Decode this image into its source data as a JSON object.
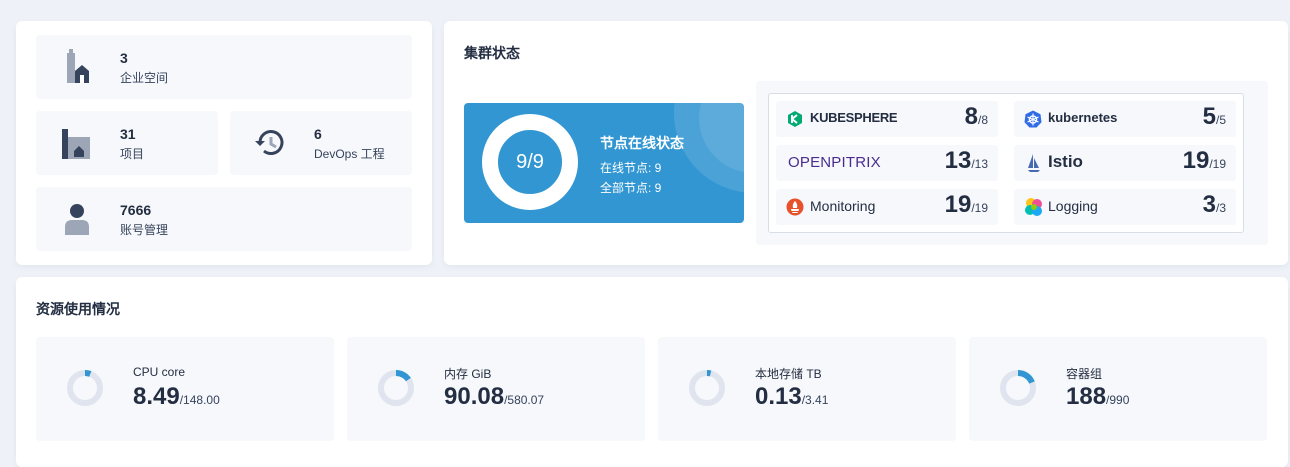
{
  "overview": {
    "workspaces": {
      "count": "3",
      "label": "企业空间",
      "icon": "enterprise-icon"
    },
    "projects": {
      "count": "31",
      "label": "项目",
      "icon": "project-icon"
    },
    "devops": {
      "count": "6",
      "label": "DevOps 工程",
      "icon": "history-icon"
    },
    "accounts": {
      "count": "7666",
      "label": "账号管理",
      "icon": "user-icon"
    }
  },
  "cluster": {
    "title": "集群状态",
    "ring_text": "9/9",
    "node_status_title": "节点在线状态",
    "online_nodes": "在线节点: 9",
    "total_nodes": "全部节点: 9",
    "accent": "#3196d1",
    "components": [
      {
        "name": "KUBESPHERE",
        "value": "8",
        "total": "/8",
        "icon": "kubesphere-logo-icon",
        "color": "#00aa72"
      },
      {
        "name": "kubernetes",
        "value": "5",
        "total": "/5",
        "icon": "kubernetes-logo-icon",
        "color": "#326ce5"
      },
      {
        "name": "OPENPITRIX",
        "value": "13",
        "total": "/13",
        "icon": "openpitrix-logo-icon",
        "color": "#4a2c90"
      },
      {
        "name": "Istio",
        "value": "19",
        "total": "/19",
        "icon": "istio-logo-icon",
        "color": "#466bb0"
      },
      {
        "name": "Monitoring",
        "value": "19",
        "total": "/19",
        "icon": "prometheus-icon",
        "color": "#e6522c"
      },
      {
        "name": "Logging",
        "value": "3",
        "total": "/3",
        "icon": "logging-icon",
        "color": "#f04e98"
      }
    ]
  },
  "resources": {
    "title": "资源使用情况",
    "items": [
      {
        "label": "CPU core",
        "value": "8.49",
        "total": "/148.00",
        "fraction": 0.0574
      },
      {
        "label": "内存 GiB",
        "value": "90.08",
        "total": "/580.07",
        "fraction": 0.1553
      },
      {
        "label": "本地存储 TB",
        "value": "0.13",
        "total": "/3.41",
        "fraction": 0.0381
      },
      {
        "label": "容器组",
        "value": "188",
        "total": "/990",
        "fraction": 0.1899
      }
    ],
    "ring_color": "#3196d1",
    "ring_track": "#dfe4ee"
  }
}
